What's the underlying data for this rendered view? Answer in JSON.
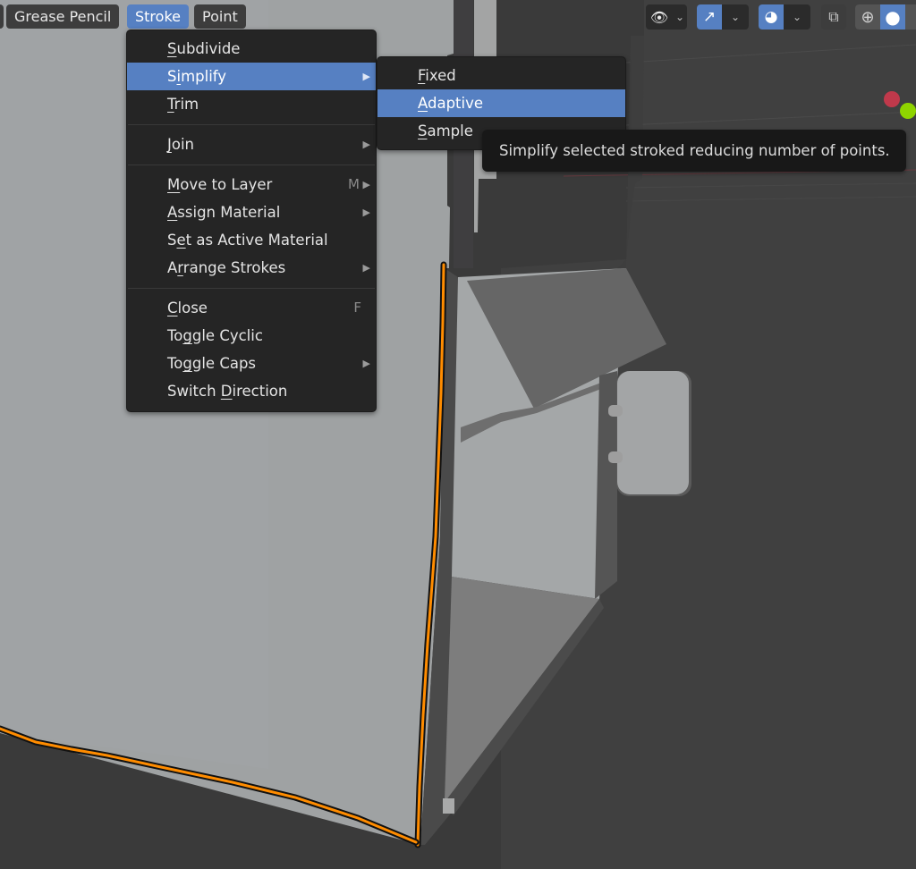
{
  "header": {
    "menus": [
      {
        "label": "Grease Pencil",
        "active": false
      },
      {
        "label": "Stroke",
        "active": true
      },
      {
        "label": "Point",
        "active": false
      }
    ]
  },
  "stroke_menu": {
    "items": [
      {
        "label": "Subdivide",
        "underline": "S",
        "highlighted": false,
        "submenu": false,
        "shortcut": ""
      },
      {
        "label": "Simplify",
        "underline": "i",
        "highlighted": true,
        "submenu": true,
        "shortcut": ""
      },
      {
        "label": "Trim",
        "underline": "T",
        "highlighted": false,
        "submenu": false,
        "shortcut": ""
      },
      {
        "label": "Join",
        "underline": "J",
        "highlighted": false,
        "submenu": true,
        "shortcut": ""
      },
      {
        "label": "Move to Layer",
        "underline": "M",
        "highlighted": false,
        "submenu": true,
        "shortcut": "M"
      },
      {
        "label": "Assign Material",
        "underline": "A",
        "highlighted": false,
        "submenu": true,
        "shortcut": ""
      },
      {
        "label": "Set as Active Material",
        "underline": "e",
        "highlighted": false,
        "submenu": false,
        "shortcut": ""
      },
      {
        "label": "Arrange Strokes",
        "underline": "r",
        "highlighted": false,
        "submenu": true,
        "shortcut": ""
      },
      {
        "label": "Close",
        "underline": "C",
        "highlighted": false,
        "submenu": false,
        "shortcut": "F"
      },
      {
        "label": "Toggle Cyclic",
        "underline": "g",
        "highlighted": false,
        "submenu": false,
        "shortcut": ""
      },
      {
        "label": "Toggle Caps",
        "underline": "g",
        "highlighted": false,
        "submenu": true,
        "shortcut": ""
      },
      {
        "label": "Switch Direction",
        "underline": "D",
        "highlighted": false,
        "submenu": false,
        "shortcut": ""
      }
    ]
  },
  "simplify_submenu": {
    "items": [
      {
        "label": "Fixed",
        "underline": "F",
        "highlighted": false
      },
      {
        "label": "Adaptive",
        "underline": "A",
        "highlighted": true
      },
      {
        "label": "Sample",
        "underline": "S",
        "highlighted": false
      }
    ]
  },
  "tooltip": {
    "text": "Simplify selected stroked reducing number of points."
  },
  "toolbar": {
    "icons": [
      {
        "name": "visibility-selectability-icon",
        "glyph": "👁"
      },
      {
        "name": "gizmo-icon",
        "glyph": "↗"
      },
      {
        "name": "overlays-icon",
        "glyph": "◕"
      },
      {
        "name": "xray-toggle-icon",
        "glyph": "⧉"
      },
      {
        "name": "wireframe-shading-icon",
        "glyph": "⊕"
      },
      {
        "name": "solid-shading-icon",
        "glyph": "●"
      }
    ],
    "chevron": "⌄"
  },
  "colors": {
    "accent": "#5680c2",
    "menu_bg": "#252525",
    "stroke_orange": "#ff8c00",
    "axis_x": "#c0394b",
    "axis_y": "#8fd400"
  }
}
